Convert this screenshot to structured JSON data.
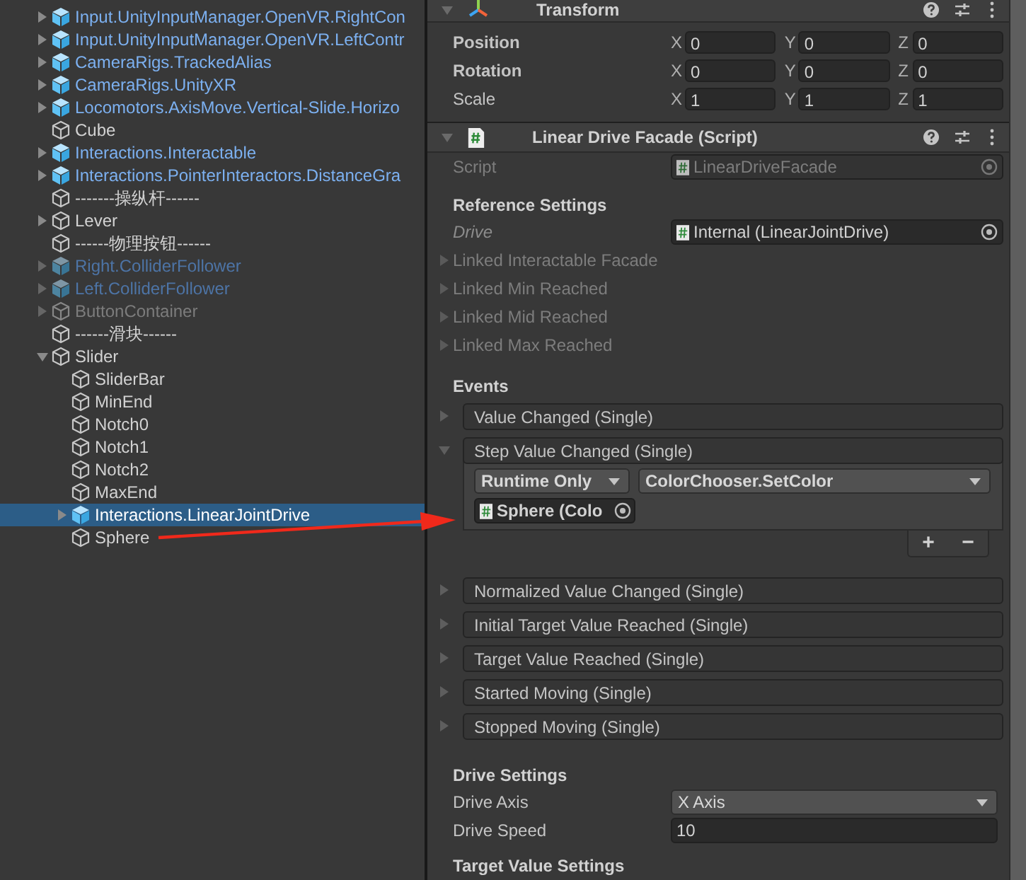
{
  "hierarchy": {
    "items": [
      {
        "name": "Input.UnityInputManager.OpenVR.RightCon",
        "kind": "prefab",
        "active": true,
        "expanded": false,
        "selected": false
      },
      {
        "name": "Input.UnityInputManager.OpenVR.LeftContr",
        "kind": "prefab",
        "active": true,
        "expanded": false,
        "selected": false
      },
      {
        "name": "CameraRigs.TrackedAlias",
        "kind": "prefab",
        "active": true,
        "expanded": false,
        "selected": false
      },
      {
        "name": "CameraRigs.UnityXR",
        "kind": "prefab",
        "active": true,
        "expanded": false,
        "selected": false
      },
      {
        "name": "Locomotors.AxisMove.Vertical-Slide.Horizo",
        "kind": "prefab",
        "active": true,
        "expanded": false,
        "selected": false
      },
      {
        "name": "Cube",
        "kind": "object",
        "active": true,
        "selected": false
      },
      {
        "name": "Interactions.Interactable",
        "kind": "prefab",
        "active": true,
        "expanded": false,
        "selected": false
      },
      {
        "name": "Interactions.PointerInteractors.DistanceGra",
        "kind": "prefab",
        "active": true,
        "expanded": false,
        "selected": false
      },
      {
        "name": "-------操纵杆------",
        "kind": "object",
        "active": true,
        "selected": false
      },
      {
        "name": "Lever",
        "kind": "object",
        "active": true,
        "expanded": false,
        "selected": false
      },
      {
        "name": "------物理按钮------",
        "kind": "object",
        "active": true,
        "selected": false
      },
      {
        "name": "Right.ColliderFollower",
        "kind": "prefab",
        "active": false,
        "expanded": false,
        "selected": false
      },
      {
        "name": "Left.ColliderFollower",
        "kind": "prefab",
        "active": false,
        "expanded": false,
        "selected": false
      },
      {
        "name": "ButtonContainer",
        "kind": "object",
        "active": false,
        "expanded": false,
        "selected": false
      },
      {
        "name": "------滑块------",
        "kind": "object",
        "active": true,
        "selected": false
      },
      {
        "name": "Slider",
        "kind": "object",
        "active": true,
        "expanded": true,
        "selected": false,
        "children": [
          {
            "name": "SliderBar",
            "kind": "object",
            "active": true,
            "selected": false
          },
          {
            "name": "MinEnd",
            "kind": "object",
            "active": true,
            "selected": false
          },
          {
            "name": "Notch0",
            "kind": "object",
            "active": true,
            "selected": false
          },
          {
            "name": "Notch1",
            "kind": "object",
            "active": true,
            "selected": false
          },
          {
            "name": "Notch2",
            "kind": "object",
            "active": true,
            "selected": false
          },
          {
            "name": "MaxEnd",
            "kind": "object",
            "active": true,
            "selected": false
          },
          {
            "name": "Interactions.LinearJointDrive",
            "kind": "prefab",
            "active": true,
            "expanded": false,
            "selected": true
          },
          {
            "name": "Sphere",
            "kind": "object",
            "active": true,
            "selected": false
          }
        ]
      }
    ]
  },
  "transform": {
    "title": "Transform",
    "rows": [
      {
        "label": "Position",
        "modified": true,
        "values": [
          {
            "axis": "X",
            "value": "0"
          },
          {
            "axis": "Y",
            "value": "0"
          },
          {
            "axis": "Z",
            "value": "0"
          }
        ]
      },
      {
        "label": "Rotation",
        "modified": true,
        "values": [
          {
            "axis": "X",
            "value": "0"
          },
          {
            "axis": "Y",
            "value": "0"
          },
          {
            "axis": "Z",
            "value": "0"
          }
        ]
      },
      {
        "label": "Scale",
        "modified": false,
        "values": [
          {
            "axis": "X",
            "value": "1"
          },
          {
            "axis": "Y",
            "value": "1"
          },
          {
            "axis": "Z",
            "value": "1"
          }
        ]
      }
    ]
  },
  "component": {
    "title": "Linear Drive Facade (Script)",
    "script": {
      "label": "Script",
      "value": "LinearDriveFacade",
      "disabled": true
    },
    "reference_settings": {
      "heading": "Reference Settings",
      "drive": {
        "label": "Drive",
        "value": "Internal (LinearJointDrive)"
      },
      "linked": [
        {
          "label": "Linked Interactable Facade",
          "expanded": false
        },
        {
          "label": "Linked Min Reached",
          "expanded": false
        },
        {
          "label": "Linked Mid Reached",
          "expanded": false
        },
        {
          "label": "Linked Max Reached",
          "expanded": false
        }
      ]
    },
    "events": {
      "heading": "Events",
      "items": [
        {
          "label": "Value Changed (Single)",
          "expanded": false
        },
        {
          "label": "Step Value Changed (Single)",
          "expanded": true,
          "listener": {
            "mode": "Runtime Only",
            "function": "ColorChooser.SetColor",
            "target": "Sphere (Colo"
          },
          "buttons": [
            "+",
            "−"
          ]
        },
        {
          "label": "Normalized Value Changed (Single)",
          "expanded": false
        },
        {
          "label": "Initial Target Value Reached (Single)",
          "expanded": false
        },
        {
          "label": "Target Value Reached (Single)",
          "expanded": false
        },
        {
          "label": "Started Moving (Single)",
          "expanded": false
        },
        {
          "label": "Stopped Moving (Single)",
          "expanded": false
        }
      ]
    },
    "drive_settings": {
      "heading": "Drive Settings",
      "axis": {
        "label": "Drive Axis",
        "value": "X Axis"
      },
      "speed": {
        "label": "Drive Speed",
        "value": "10"
      }
    },
    "target_value_settings": {
      "heading": "Target Value Settings"
    }
  }
}
